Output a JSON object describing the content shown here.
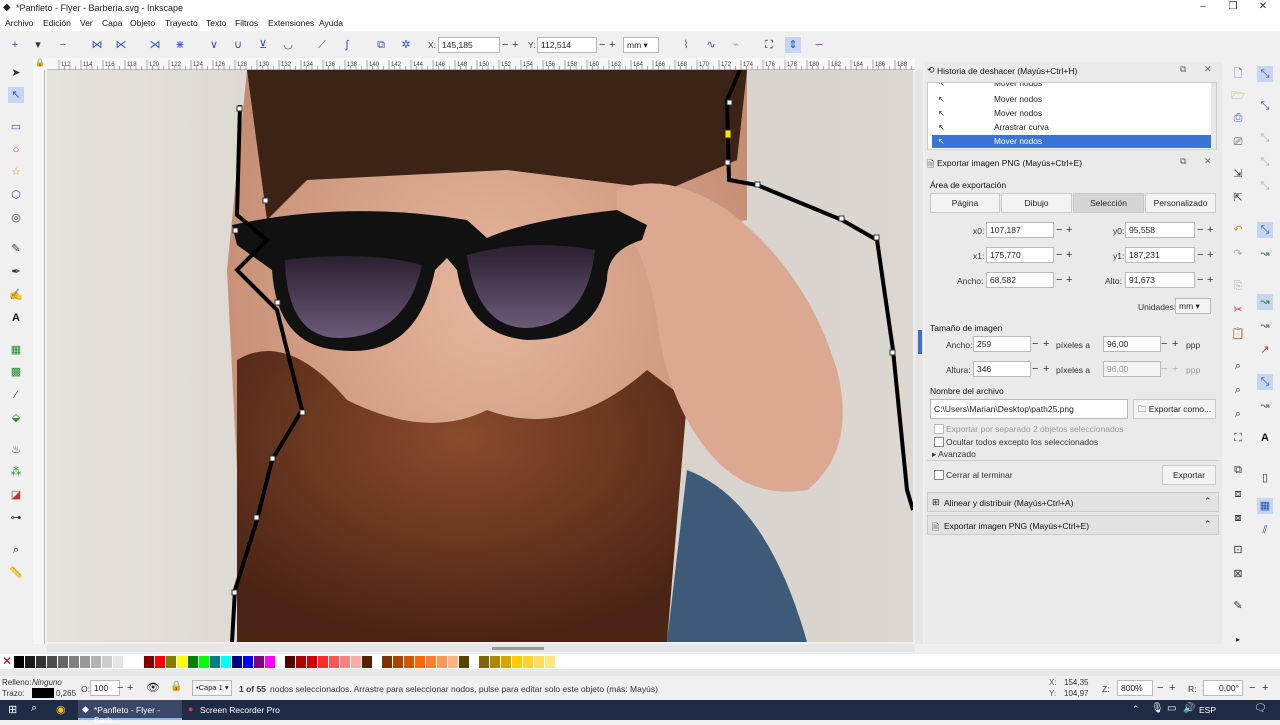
{
  "window": {
    "title": "*Panfleto - Flyer - Barberia.svg - Inkscape",
    "min": "–",
    "max": "❐",
    "close": "✕"
  },
  "menu": [
    "Archivo",
    "Edición",
    "Ver",
    "Capa",
    "Objeto",
    "Trayecto",
    "Texto",
    "Filtros",
    "Extensiones",
    "Ayuda"
  ],
  "toolbar": {
    "x_label": "X:",
    "x_value": "145,185",
    "y_label": "Y:",
    "y_value": "112,514",
    "unit": "mm",
    "minus": "−",
    "plus": "+"
  },
  "ruler_labels": [
    "112",
    "114",
    "116",
    "118",
    "120",
    "122",
    "124",
    "126",
    "128",
    "130",
    "132",
    "134",
    "136",
    "138",
    "140",
    "142",
    "144",
    "146",
    "148",
    "150",
    "152",
    "154",
    "156",
    "158",
    "160",
    "162",
    "164",
    "166",
    "168",
    "170",
    "172",
    "174",
    "176",
    "178",
    "180",
    "182",
    "184",
    "186",
    "188",
    "190"
  ],
  "history": {
    "title": "Historia de deshacer (Mayús+Ctrl+H)",
    "items": [
      "Mover nodos",
      "Mover nodos",
      "Mover nodos",
      "Arrastrar curva",
      "Mover nodos"
    ],
    "selected_index": 4
  },
  "export": {
    "title": "Exportar imagen PNG (Mayús+Ctrl+E)",
    "area_label": "Área de exportación",
    "area_buttons": [
      "Página",
      "Dibujo",
      "Selección",
      "Personalizado"
    ],
    "active_area": "Selección",
    "x0_label": "x0:",
    "x0": "107,187",
    "y0_label": "y0:",
    "y0": "95,558",
    "x1_label": "x1:",
    "x1": "175,770",
    "y1_label": "y1:",
    "y1": "187,231",
    "width_label": "Ancho:",
    "width": "68,582",
    "height_label": "Alto:",
    "height": "91,673",
    "units_label": "Unidades:",
    "units": "mm",
    "image_size_label": "Tamaño de imagen",
    "img_w_label": "Ancho:",
    "img_w": "259",
    "px_at": "píxeles a",
    "dpi": "96,00",
    "dpi_unit": "ppp",
    "img_h_label": "Altura:",
    "img_h": "346",
    "px_at2": "píxeles a",
    "dpi2": "96,00",
    "dpi_unit2": "ppp",
    "filename_label": "Nombre del archivo",
    "filename": "C:\\Users\\Marian\\Desktop\\path25.png",
    "export_as": "Exportar como...",
    "opt_separate": "Exportar por separado 2 objetos seleccionados",
    "opt_hide": "Ocultar todos excepto los seleccionados",
    "advanced": "Avanzado",
    "close_when_done": "Cerrar al terminar",
    "export_button": "Exportar"
  },
  "collapsed_panels": [
    "Alinear y distribuir (Mayús+Ctrl+A)",
    "Exportar imagen PNG (Mayús+Ctrl+E)"
  ],
  "palette_colors": [
    "#000000",
    "#1a1a1a",
    "#333333",
    "#4d4d4d",
    "#666666",
    "#808080",
    "#999999",
    "#b3b3b3",
    "#cccccc",
    "#e6e6e6",
    "#ffffff",
    "#800000",
    "#ff0000",
    "#808000",
    "#ffff00",
    "#008000",
    "#00ff00",
    "#008080",
    "#00ffff",
    "#000080",
    "#0000ff",
    "#800080",
    "#ff00ff",
    "#550000",
    "#aa0000",
    "#d40000",
    "#ff2a2a",
    "#ff5555",
    "#ff8080",
    "#ffaaaa",
    "#552200",
    "#803300",
    "#aa4400",
    "#d45500",
    "#ff6600",
    "#ff7f2a",
    "#ff9955",
    "#ffb380",
    "#554400",
    "#806600",
    "#aa8800",
    "#d4aa00",
    "#ffcc00",
    "#ffd42a",
    "#ffdd55",
    "#ffe680"
  ],
  "status": {
    "fill_label": "Relleno:",
    "fill_value": "Ninguno",
    "stroke_label": "Trazo:",
    "stroke_width": "0,265",
    "opacity_label": "O:",
    "opacity": "100",
    "layer": "•Capa 1",
    "message_bold": "1 of 55",
    "message": " nodos seleccionados. Arrastre para seleccionar nodos, pulse para editar solo este objeto (más: Mayús)",
    "coord_x_label": "X:",
    "coord_x": "154,35",
    "coord_y_label": "Y:",
    "coord_y": "104,97",
    "zoom_label": "Z:",
    "zoom": "800%",
    "rot_label": "R:",
    "rotation": "0,00°"
  },
  "taskbar": {
    "items": [
      "*Panfleto - Flyer - Barb...",
      "Screen Recorder Pro"
    ],
    "lang": "ESP"
  }
}
